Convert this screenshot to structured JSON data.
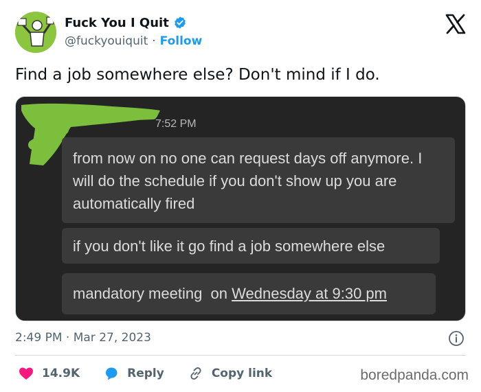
{
  "author": {
    "name": "Fuck You I Quit",
    "handle": "@fuckyouiquit",
    "separator": "·",
    "follow_label": "Follow"
  },
  "icons": {
    "verified": "verified-badge-icon",
    "brand": "x-logo-icon",
    "info": "info-icon",
    "like": "heart-icon",
    "reply": "reply-bubble-icon",
    "copy": "link-icon"
  },
  "tweet": {
    "text": "Find a job somewhere else? Don't mind if I do."
  },
  "screenshot": {
    "time": "7:52 PM",
    "messages": [
      "from now on no one can request days off anymore. I will do the schedule if you don't show up you are automatically fired",
      "if you don't like it go find a job somewhere else"
    ],
    "meeting": {
      "prefix": "mandatory meeting  on ",
      "link": "Wednesday at 9:30 pm"
    }
  },
  "meta": {
    "timestamp": "2:49 PM · Mar 27, 2023"
  },
  "actions": {
    "likes": "14.9K",
    "reply": "Reply",
    "copy": "Copy link"
  },
  "watermark": "boredpanda.com",
  "colors": {
    "accent": "#1d9bf0",
    "like": "#f91880",
    "avatar_bg": "#8cc63f",
    "scribble": "#7bbf3c",
    "chat_bg": "#242424",
    "bubble_bg": "#3a3a3a"
  }
}
